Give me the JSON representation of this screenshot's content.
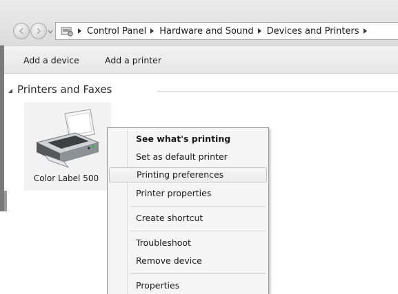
{
  "breadcrumb": {
    "items": [
      "Control Panel",
      "Hardware and Sound",
      "Devices and Printers"
    ]
  },
  "toolbar": {
    "add_device": "Add a device",
    "add_printer": "Add a printer"
  },
  "group": {
    "header": "Printers and Faxes"
  },
  "device": {
    "label": "Color Label 500",
    "icon": "printer-icon"
  },
  "context_menu": {
    "items": [
      "See what's printing",
      "Set as default printer",
      "Printing preferences",
      "Printer properties",
      "Create shortcut",
      "Troubleshoot",
      "Remove device",
      "Properties"
    ],
    "bold_item": "See what's printing",
    "highlighted_item": "Printing preferences"
  }
}
